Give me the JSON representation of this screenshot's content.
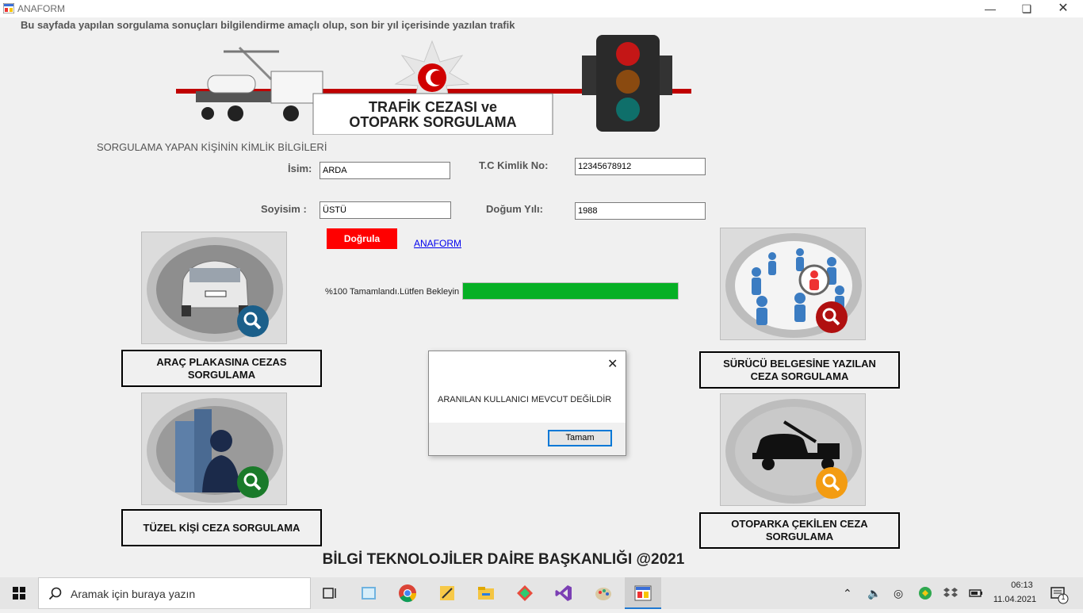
{
  "window": {
    "title": "ANAFORM"
  },
  "info_text": "Bu sayfada yapılan sorgulama sonuçları bilgilendirme amaçlı olup, son bir yıl içerisinde yazılan trafik",
  "banner": {
    "line1": "TRAFİK CEZASI ve",
    "line2": "OTOPARK SORGULAMA"
  },
  "form": {
    "section_title": "SORGULAMA YAPAN KİŞİNİN KİMLİK BİLGİLERİ",
    "name_label": "İsim:",
    "name_value": "ARDA",
    "surname_label": "Soyisim :",
    "surname_value": "ÜSTÜ",
    "tc_label": "T.C Kimlik No:",
    "tc_value": "12345678912",
    "birth_label": "Doğum Yılı:",
    "birth_value": "1988",
    "verify_button": "Doğrula",
    "link_text": "ANAFORM"
  },
  "progress": {
    "label": "%100 Tamamlandı.Lütfen Bekleyin",
    "value": 100,
    "color": "#06b025"
  },
  "tiles": {
    "vehicle": "ARAÇ PLAKASINA CEZAS SORGULAMA",
    "license": "SÜRÜCÜ BELGESİNE YAZILAN CEZA SORGULAMA",
    "legal": "TÜZEL KİŞİ CEZA SORGULAMA",
    "towed": "OTOPARKA ÇEKİLEN CEZA SORGULAMA"
  },
  "footer": "BİLGİ TEKNOLOJİLER DAİRE BAŞKANLIĞI @2021",
  "dialog": {
    "message": "ARANILAN KULLANICI MEVCUT DEĞİLDİR",
    "ok_button": "Tamam"
  },
  "taskbar": {
    "search_placeholder": "Aramak için buraya yazın",
    "time": "06:13",
    "date": "11.04.2021",
    "notification_count": "1"
  },
  "icons": [
    "windows-start-icon",
    "search-icon",
    "task-view-icon",
    "chrome-icon",
    "file-explorer-icon",
    "visual-studio-icon",
    "paint-icon"
  ],
  "colors": {
    "accent_red": "#ff0000",
    "progress_green": "#06b025",
    "link_blue": "#0000ee"
  }
}
